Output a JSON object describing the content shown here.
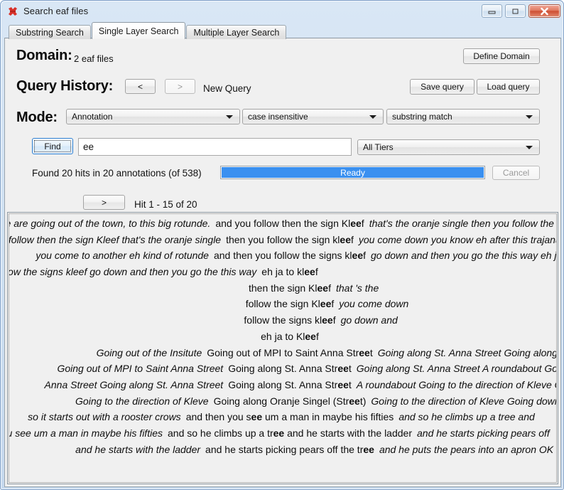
{
  "window": {
    "title": "Search eaf files",
    "icon": "elan-logo-icon",
    "controls": {
      "minimize": "minimize-icon",
      "maximize": "maximize-icon",
      "close": "close-icon"
    }
  },
  "tabs": [
    {
      "label": "Substring Search",
      "selected": false
    },
    {
      "label": "Single Layer Search",
      "selected": true
    },
    {
      "label": "Multiple Layer Search",
      "selected": false
    }
  ],
  "domain": {
    "label": "Domain:",
    "value": "2 eaf files",
    "define_button": "Define Domain"
  },
  "query_history": {
    "label": "Query History:",
    "prev_button": "<",
    "next_button": ">",
    "status": "New Query",
    "save_button": "Save query",
    "load_button": "Load query"
  },
  "mode": {
    "label": "Mode:",
    "type_value": "Annotation",
    "case_value": "case insensitive",
    "match_value": "substring match"
  },
  "search": {
    "find_button": "Find",
    "query_value": "ee",
    "query_placeholder": "",
    "tier_value": "All Tiers"
  },
  "status": {
    "found_text": "Found 20 hits in 20 annotations (of 538)",
    "progress_label": "Ready",
    "progress_percent": 100,
    "progress_color": "#3a90f0",
    "cancel_button": "Cancel"
  },
  "navigation": {
    "next_button": ">",
    "hit_range": "Hit 1 - 15 of 20"
  },
  "results": {
    "rows": [
      {
        "left": "we are going out of the town, to this big rotunde.",
        "hit_pre": "and you follow then the sign Kl",
        "hit": "ee",
        "hit_post": "f",
        "right": "that's the oranje single  then you follow the sign kleef  you come down"
      },
      {
        "left": "and you follow then the sign Kleef  that's the oranje single",
        "hit_pre": "then you follow the sign kl",
        "hit": "ee",
        "hit_post": "f",
        "right": "you come down  you know eh after this trajanus plein  you come"
      },
      {
        "left": "you come to another eh  kind of rotunde",
        "hit_pre": "and then you follow the signs kl",
        "hit": "ee",
        "hit_post": "f",
        "right": "go down  and then you go the this way  eh ja to kleef"
      },
      {
        "left": "you follow the signs kleef  go down  and then you go the this way",
        "hit_pre": "eh ja to kl",
        "hit": "ee",
        "hit_post": "f",
        "right": ""
      },
      {
        "left": "",
        "hit_pre": "then  the  sign  Kl",
        "hit": "ee",
        "hit_post": "f",
        "right": "that  's  the"
      },
      {
        "left": "",
        "hit_pre": "follow  the  sign  Kl",
        "hit": "ee",
        "hit_post": "f",
        "right": "you  come  down"
      },
      {
        "left": "",
        "hit_pre": "follow  the  signs  kl",
        "hit": "ee",
        "hit_post": "f",
        "right": "go  down  and"
      },
      {
        "left": "",
        "hit_pre": "eh  ja  to  Kl",
        "hit": "ee",
        "hit_post": "f",
        "right": ""
      },
      {
        "left": "Going out of the Insitute",
        "hit_pre": "Going out of MPI to Saint Anna Str",
        "hit": "ee",
        "hit_post": "t",
        "right": "Going along St. Anna Street  Going along St. Anna Street  A"
      },
      {
        "left": "Going out of MPI to Saint Anna Street",
        "hit_pre": "Going along St. Anna Str",
        "hit": "ee",
        "hit_post": "t",
        "right": "Going along St. Anna Street  A roundabout  Going to the dir"
      },
      {
        "left": "Anna Street  Going along St. Anna Street",
        "hit_pre": "Going along St. Anna Str",
        "hit": "ee",
        "hit_post": "t",
        "right": "A roundabout  Going to the direction of Kleve  Going along"
      },
      {
        "left": "Going to the direction of Kleve",
        "hit_pre": "Going along Oranje Singel (Str",
        "hit": "ee",
        "hit_post": "t)",
        "right": "Going to the direction of Kleve  Going down  a roundabout"
      },
      {
        "left": "so it starts out with a rooster crows",
        "hit_pre": "and then you s",
        "hit": "ee",
        "hit_post": " um a man in maybe his fifties",
        "right": "and so he climbs up a tree and"
      },
      {
        "left": "you see um a man in maybe his fifties",
        "hit_pre": "and so he climbs up a tr",
        "hit": "ee",
        "hit_post": " and he starts with the ladder",
        "right": "and he starts picking pears off"
      },
      {
        "left": "and he starts with the ladder",
        "hit_pre": "and he starts picking pears off the tr",
        "hit": "ee",
        "hit_post": "",
        "right": "and he puts the pears into an apron  OK  and so then he ga"
      }
    ]
  }
}
